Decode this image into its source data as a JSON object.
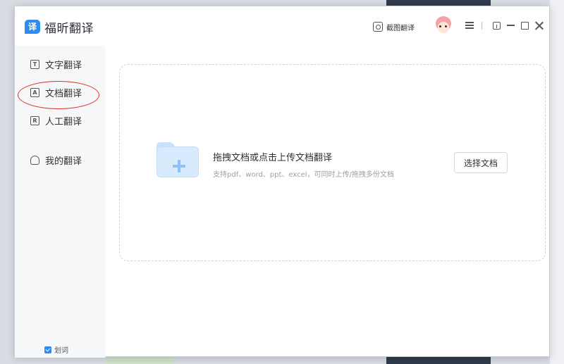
{
  "app": {
    "logo_glyph": "译",
    "title": "福昕翻译"
  },
  "titlebar": {
    "screenshot_translate": "截图翻译"
  },
  "sidebar": {
    "items": [
      {
        "label": "文字翻译",
        "icon_glyph": "T"
      },
      {
        "label": "文档翻译",
        "icon_glyph": "A"
      },
      {
        "label": "人工翻译",
        "icon_glyph": "R"
      },
      {
        "label": "我的翻译",
        "icon_glyph": ""
      }
    ],
    "word_pick_label": "划词"
  },
  "main": {
    "drop_title": "拖拽文档或点击上传文档翻译",
    "drop_hint": "支持pdf、word、ppt、excel，可同时上传/拖拽多份文档",
    "choose_button": "选择文档"
  },
  "colors": {
    "accent": "#2e8bf0",
    "highlight_oval": "#d9322b"
  }
}
